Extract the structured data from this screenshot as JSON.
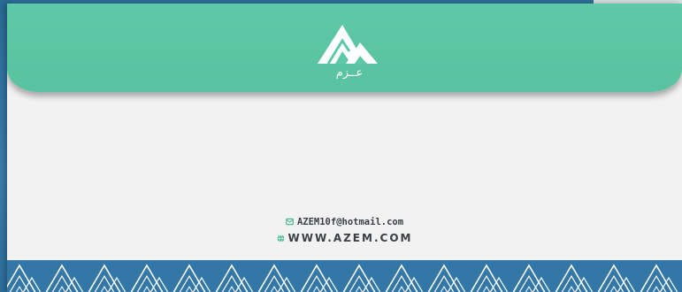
{
  "logo": {
    "icon": "azem-mountain-logo-icon",
    "arabic_text": "عــزم"
  },
  "contact": {
    "email": "AZEM10f@hotmail.com",
    "email_icon": "mail-icon",
    "website": "WWW.AZEM.COM",
    "website_icon": "globe-icon"
  },
  "colors": {
    "flap": "#5ec9a6",
    "paper": "#f2f2f2",
    "pattern_bg": "#3277a6",
    "text": "#3b3f45"
  }
}
